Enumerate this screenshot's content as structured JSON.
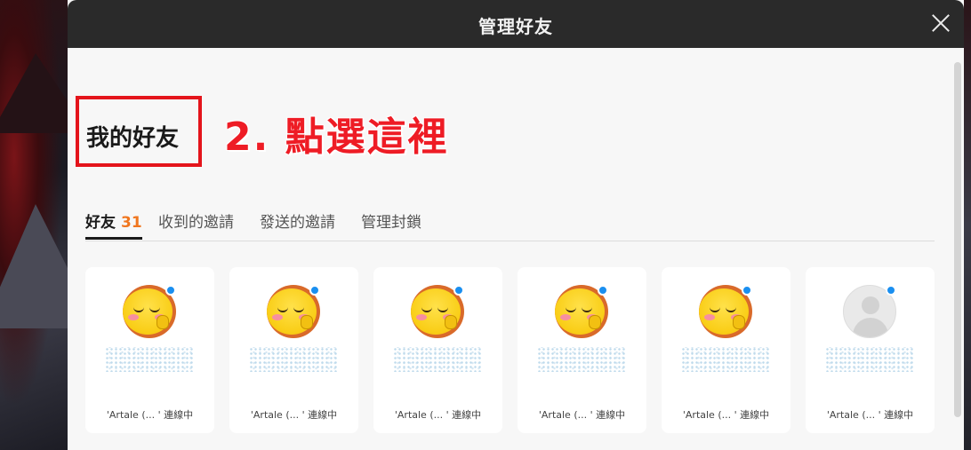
{
  "dialog": {
    "title": "管理好友",
    "close_icon": "close-icon"
  },
  "section": {
    "heading": "我的好友"
  },
  "annotation": {
    "text": "2. 點選這裡",
    "color": "#ee1c25"
  },
  "tabs": [
    {
      "label": "好友",
      "count": "31",
      "active": true
    },
    {
      "label": "收到的邀請",
      "active": false
    },
    {
      "label": "發送的邀請",
      "active": false
    },
    {
      "label": "管理封鎖",
      "active": false
    }
  ],
  "colors": {
    "accent_count": "#f0761f",
    "online_dot": "#1a8ff0",
    "highlight_box": "#e4141b"
  },
  "friends": [
    {
      "avatar": "yellow-emoji-avatar",
      "online": true,
      "status": "'Artale (...   ' 連線中"
    },
    {
      "avatar": "yellow-emoji-avatar",
      "online": true,
      "status": "'Artale (...   ' 連線中"
    },
    {
      "avatar": "yellow-emoji-avatar",
      "online": true,
      "status": "'Artale (...   ' 連線中"
    },
    {
      "avatar": "yellow-emoji-avatar",
      "online": true,
      "status": "'Artale (...   ' 連線中"
    },
    {
      "avatar": "yellow-emoji-avatar",
      "online": true,
      "status": "'Artale (...   ' 連線中"
    },
    {
      "avatar": "default-user-avatar",
      "online": true,
      "status": "'Artale (...   ' 連線中"
    }
  ]
}
